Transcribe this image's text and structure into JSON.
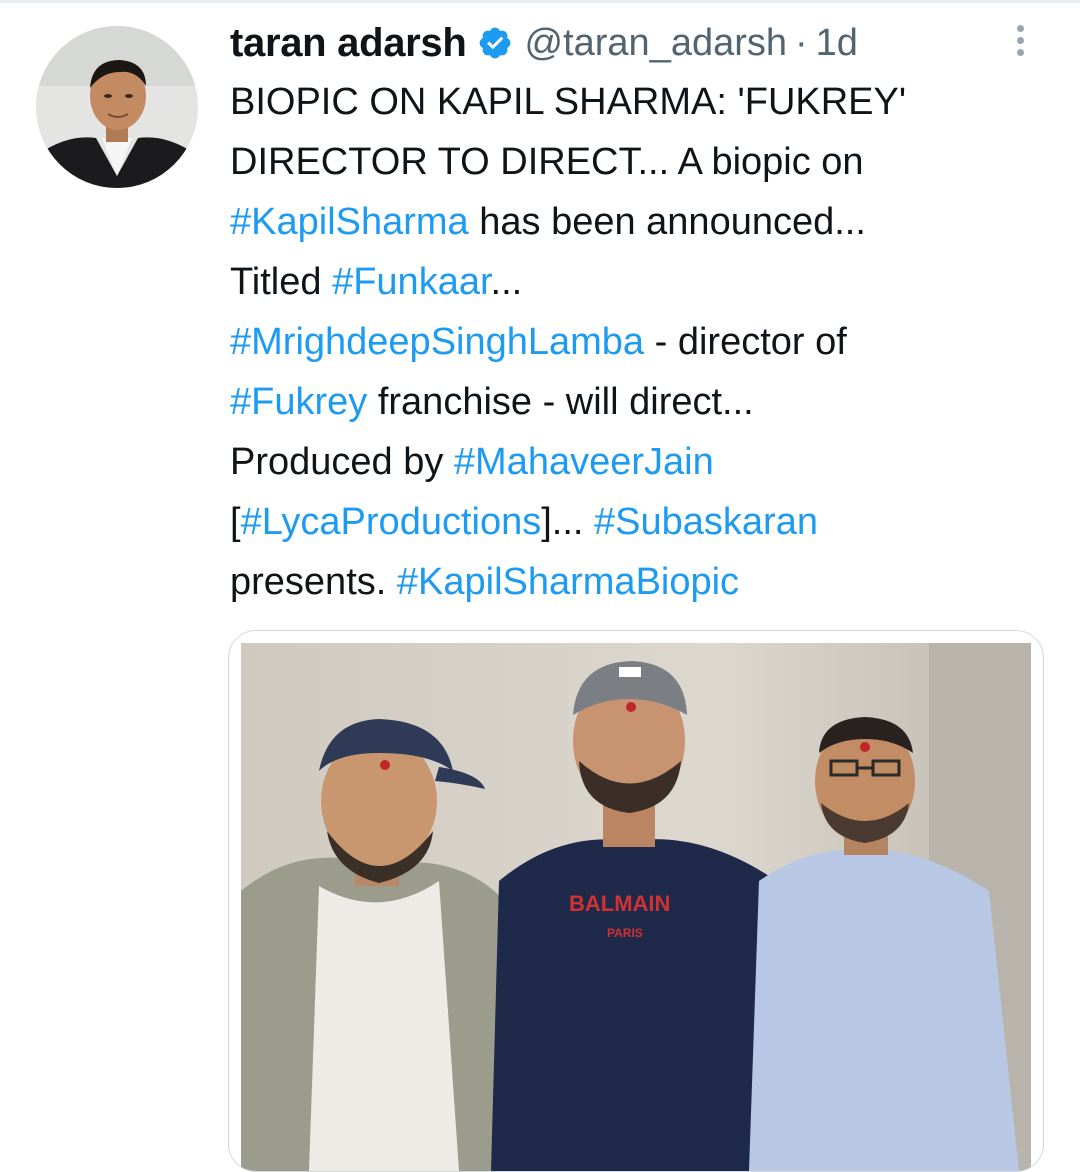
{
  "tweet": {
    "author": {
      "display_name": "taran adarsh",
      "handle": "@taran_adarsh",
      "verified_icon": "verified-badge-icon",
      "avatar_icon": "profile-photo"
    },
    "separator": "·",
    "timestamp": "1d",
    "more_icon": "more-options-icon",
    "body": {
      "l1": "BIOPIC ON KAPIL SHARMA: 'FUKREY'",
      "l2": "DIRECTOR TO DIRECT... A biopic on",
      "l3_tag": "#KapilSharma",
      "l3_rest": " has been announced...",
      "l4_text": "Titled ",
      "l4_tag": "#Funkaar",
      "l4_rest": "...",
      "l5_tag": "#MrighdeepSinghLamba",
      "l5_rest": " - director of",
      "l6_tag": "#Fukrey",
      "l6_rest": " franchise - will direct...",
      "l7_text": "Produced by ",
      "l7_tag": "#MahaveerJain",
      "l8_open": "[",
      "l8_tag": "#LycaProductions",
      "l8_mid": "]... ",
      "l8_tag2": "#Subaskaran",
      "l9_text": "presents. ",
      "l9_tag": "#KapilSharmaBiopic"
    },
    "media": {
      "shirt_text": "BALMAIN",
      "shirt_subtext": "PARIS"
    },
    "colors": {
      "hashtag": "#1d9bf0",
      "verified": "#1d9bf0",
      "muted": "#536471",
      "text": "#0f1419"
    }
  }
}
